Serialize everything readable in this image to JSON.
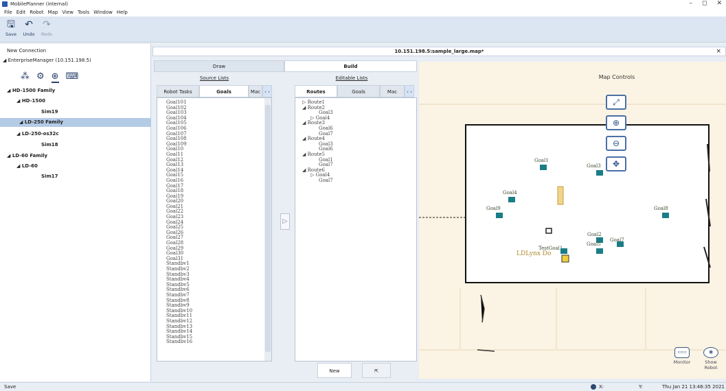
{
  "window": {
    "title": "MobilePlanner (internal)",
    "controls": [
      "–",
      "◻",
      "✕"
    ]
  },
  "menu": [
    "File",
    "Edit",
    "Robot",
    "Map",
    "View",
    "Tools",
    "Window",
    "Help"
  ],
  "toolbar": {
    "save": "Save",
    "undo": "Undo",
    "redo": "Redo"
  },
  "sidebar": {
    "connection": "New Connection",
    "manager": "EnterpriseManager (10.151.198.5)",
    "tree": [
      {
        "label": "HD-1500 Family"
      },
      {
        "label": "HD-1500"
      },
      {
        "label": "Sim19"
      },
      {
        "label": "LD-250 Family"
      },
      {
        "label": "LD-250-os32c"
      },
      {
        "label": "Sim18"
      },
      {
        "label": "LD-60 Family"
      },
      {
        "label": "LD-60"
      },
      {
        "label": "Sim17"
      }
    ]
  },
  "document": {
    "tab_title": "10.151.198.5:sample_large.map*",
    "close": "×"
  },
  "modes": {
    "draw": "Draw",
    "build": "Build"
  },
  "source_lists": {
    "header": "Source Lists",
    "tabs": [
      "Robot Tasks",
      "Goals",
      "Mac"
    ],
    "items": [
      "Goal101",
      "Goal102",
      "Goal103",
      "Goal104",
      "Goal105",
      "Goal106",
      "Goal107",
      "Goal108",
      "Goal109",
      "Goal10",
      "Goal11",
      "Goal12",
      "Goal13",
      "Goal14",
      "Goal15",
      "Goal16",
      "Goal17",
      "Goal18",
      "Goal19",
      "Goal20",
      "Goal21",
      "Goal22",
      "Goal23",
      "Goal24",
      "Goal25",
      "Goal26",
      "Goal27",
      "Goal28",
      "Goal29",
      "Goal30",
      "Goal31",
      "Standbv1",
      "Standbv2",
      "Standbv3",
      "Standbv4",
      "Standbv5",
      "Standbv6",
      "Standbv7",
      "Standbv8",
      "Standbv9",
      "Standbv10",
      "Standbv11",
      "Standbv12",
      "Standbv13",
      "Standbv14",
      "Standbv15",
      "Standbv16"
    ]
  },
  "editable_lists": {
    "header": "Editable Lists",
    "tabs": [
      "Routes",
      "Goals",
      "Mac"
    ],
    "routes": [
      {
        "label": "Route1",
        "prefix": "▷ ",
        "indent": 0
      },
      {
        "label": "Route2",
        "prefix": "◢ ",
        "indent": 0
      },
      {
        "label": "Goal3",
        "prefix": "",
        "indent": 2
      },
      {
        "label": "Goal4",
        "prefix": "▷ ",
        "indent": 1
      },
      {
        "label": "Route3",
        "prefix": "◢ ",
        "indent": 0
      },
      {
        "label": "Goal6",
        "prefix": "",
        "indent": 2
      },
      {
        "label": "Goal7",
        "prefix": "",
        "indent": 2
      },
      {
        "label": "Route4",
        "prefix": "◢ ",
        "indent": 0
      },
      {
        "label": "Goal3",
        "prefix": "",
        "indent": 2
      },
      {
        "label": "Goal6",
        "prefix": "",
        "indent": 2
      },
      {
        "label": "Route5",
        "prefix": "◢ ",
        "indent": 0
      },
      {
        "label": "Goal1",
        "prefix": "",
        "indent": 2
      },
      {
        "label": "Goal7",
        "prefix": "",
        "indent": 2
      },
      {
        "label": "Route6",
        "prefix": "◢ ",
        "indent": 0
      },
      {
        "label": "Goal4",
        "prefix": "▷ ",
        "indent": 1
      },
      {
        "label": "Goal7",
        "prefix": "",
        "indent": 2
      }
    ],
    "new_button": "New"
  },
  "map": {
    "controls_label": "Map Controls",
    "goals": [
      "Goal1",
      "Goal3",
      "Goal4",
      "Goal9",
      "Goal8",
      "Goal2",
      "Goal7",
      "Goal5",
      "TestGoal1",
      "LDLynx Do"
    ],
    "monitor": "Monitor",
    "show_robot": "Show Robot"
  },
  "status": {
    "left": "Save",
    "x": "X:",
    "y": "Y:",
    "time": "Thu Jan 21 13:46:35 2021"
  }
}
